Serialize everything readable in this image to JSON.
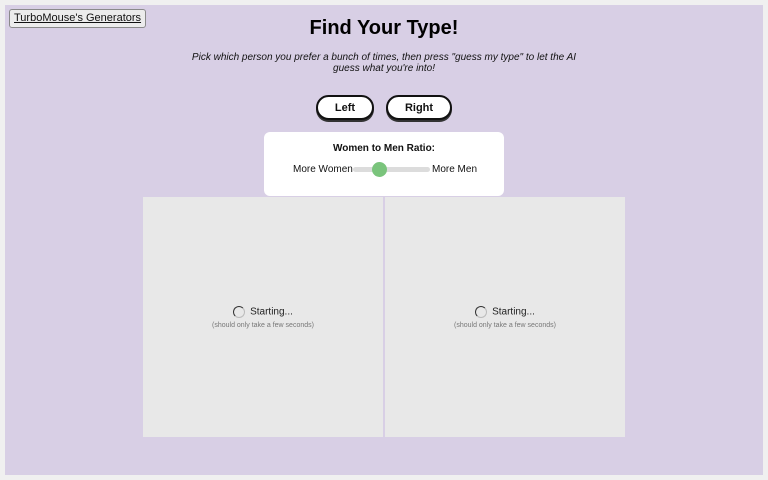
{
  "header": {
    "home_link": "TurboMouse's Generators",
    "title": "Find Your Type!",
    "subtitle": "Pick which person you prefer a bunch of times, then press \"guess my type\" to let the AI guess what you're into!"
  },
  "choices": {
    "left_label": "Left",
    "right_label": "Right"
  },
  "ratio": {
    "title": "Women to Men Ratio:",
    "left_label": "More Women",
    "right_label": "More Men",
    "value": 0.35,
    "accent_color": "#7ac47c"
  },
  "panels": [
    {
      "status": "Starting...",
      "note": "(should only take a few seconds)",
      "icon": "spinner-icon"
    },
    {
      "status": "Starting...",
      "note": "(should only take a few seconds)",
      "icon": "spinner-icon"
    }
  ],
  "colors": {
    "page_background": "#d8cfe5",
    "panel_background": "#e8e8e8"
  }
}
